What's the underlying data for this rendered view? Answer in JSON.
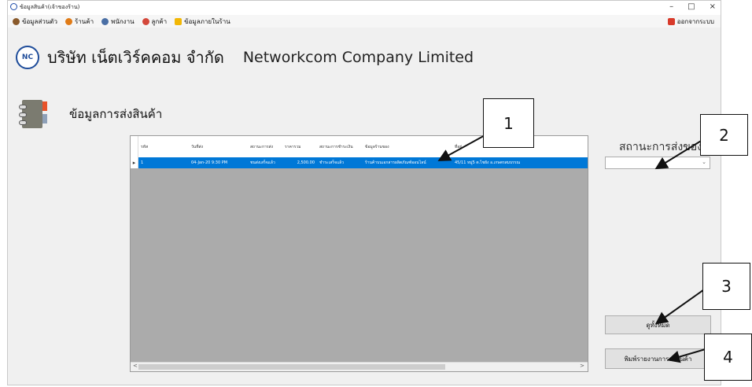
{
  "window": {
    "title": "ข้อมูลสินค้า(เจ้าของร้าน)",
    "controls": {
      "minimize": "–",
      "maximize": "□",
      "close": "×"
    }
  },
  "menu": {
    "items": [
      {
        "label": "ข้อมูลส่วนตัว",
        "icon": "user-icon",
        "color": "#8a5a2b"
      },
      {
        "label": "ร้านค้า",
        "icon": "shop-icon",
        "color": "#e07b17"
      },
      {
        "label": "พนักงาน",
        "icon": "staff-icon",
        "color": "#4a6fa5"
      },
      {
        "label": "ลูกค้า",
        "icon": "customer-icon",
        "color": "#d4483b"
      },
      {
        "label": "ข้อมูลภายในร้าน",
        "icon": "folder-icon",
        "color": "#f2b705"
      }
    ],
    "logout": {
      "label": "ออกจากระบบ",
      "icon": "logout-icon",
      "color": "#d83a2a"
    }
  },
  "company": {
    "logo_text": "NC",
    "name_th": "บริษัท เน็ตเวิร์คคอม จำกัด",
    "name_en": "Networkcom Company Limited"
  },
  "section": {
    "title": "ข้อมูลการส่งสินค้า",
    "icon": "notebook-icon"
  },
  "grid": {
    "columns": [
      "รหัส",
      "วันที่ส่ง",
      "สถานะการส่ง",
      "ราคารวม",
      "สถานะการชำระเงิน",
      "ข้อมูลร้านของ",
      "ที่อยู่"
    ],
    "rows": [
      [
        "1",
        "04-Jan-20 9:30 PM",
        "ชนส่งเสร็จแล้ว",
        "2,500.00",
        "ชำระเสร็จแล้ว",
        "ร้านค้าบนเอกสารผลิตภัณฑ์ออนไลน์",
        "45/11 หมู่5 ต.ไชยัง อ.เกษตรสมบรรณ"
      ]
    ],
    "selected_color": "#0078d7"
  },
  "status_panel": {
    "label": "สถานะการส่งของ",
    "selected": ""
  },
  "buttons": {
    "view_all": "ดูทั้งหมด",
    "print": "พิมพ์รายงานการส่งสินค้า"
  },
  "callouts": [
    "1",
    "2",
    "3",
    "4"
  ]
}
